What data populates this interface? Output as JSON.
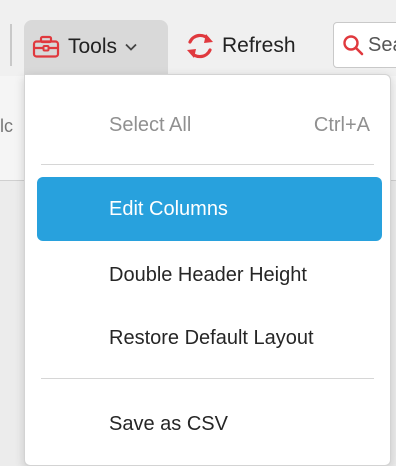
{
  "toolbar": {
    "tools_label": "Tools",
    "refresh_label": "Refresh",
    "search_placeholder": "Search"
  },
  "grid": {
    "partial_column_text": "lc"
  },
  "menu": {
    "select_all": {
      "label": "Select All",
      "shortcut": "Ctrl+A",
      "enabled": false
    },
    "edit_columns": {
      "label": "Edit Columns",
      "highlighted": true
    },
    "double_header": {
      "label": "Double Header Height"
    },
    "restore_layout": {
      "label": "Restore Default Layout"
    },
    "save_csv": {
      "label": "Save as CSV"
    }
  },
  "colors": {
    "accent": "#28a1dd",
    "icon_red": "#e0393e",
    "toolbar_bg": "#f0f0f0",
    "menu_bg": "#ffffff"
  },
  "icons": {
    "tools": "toolbox-icon",
    "tools_dropdown": "chevron-down-icon",
    "refresh": "refresh-icon",
    "search": "search-icon"
  }
}
